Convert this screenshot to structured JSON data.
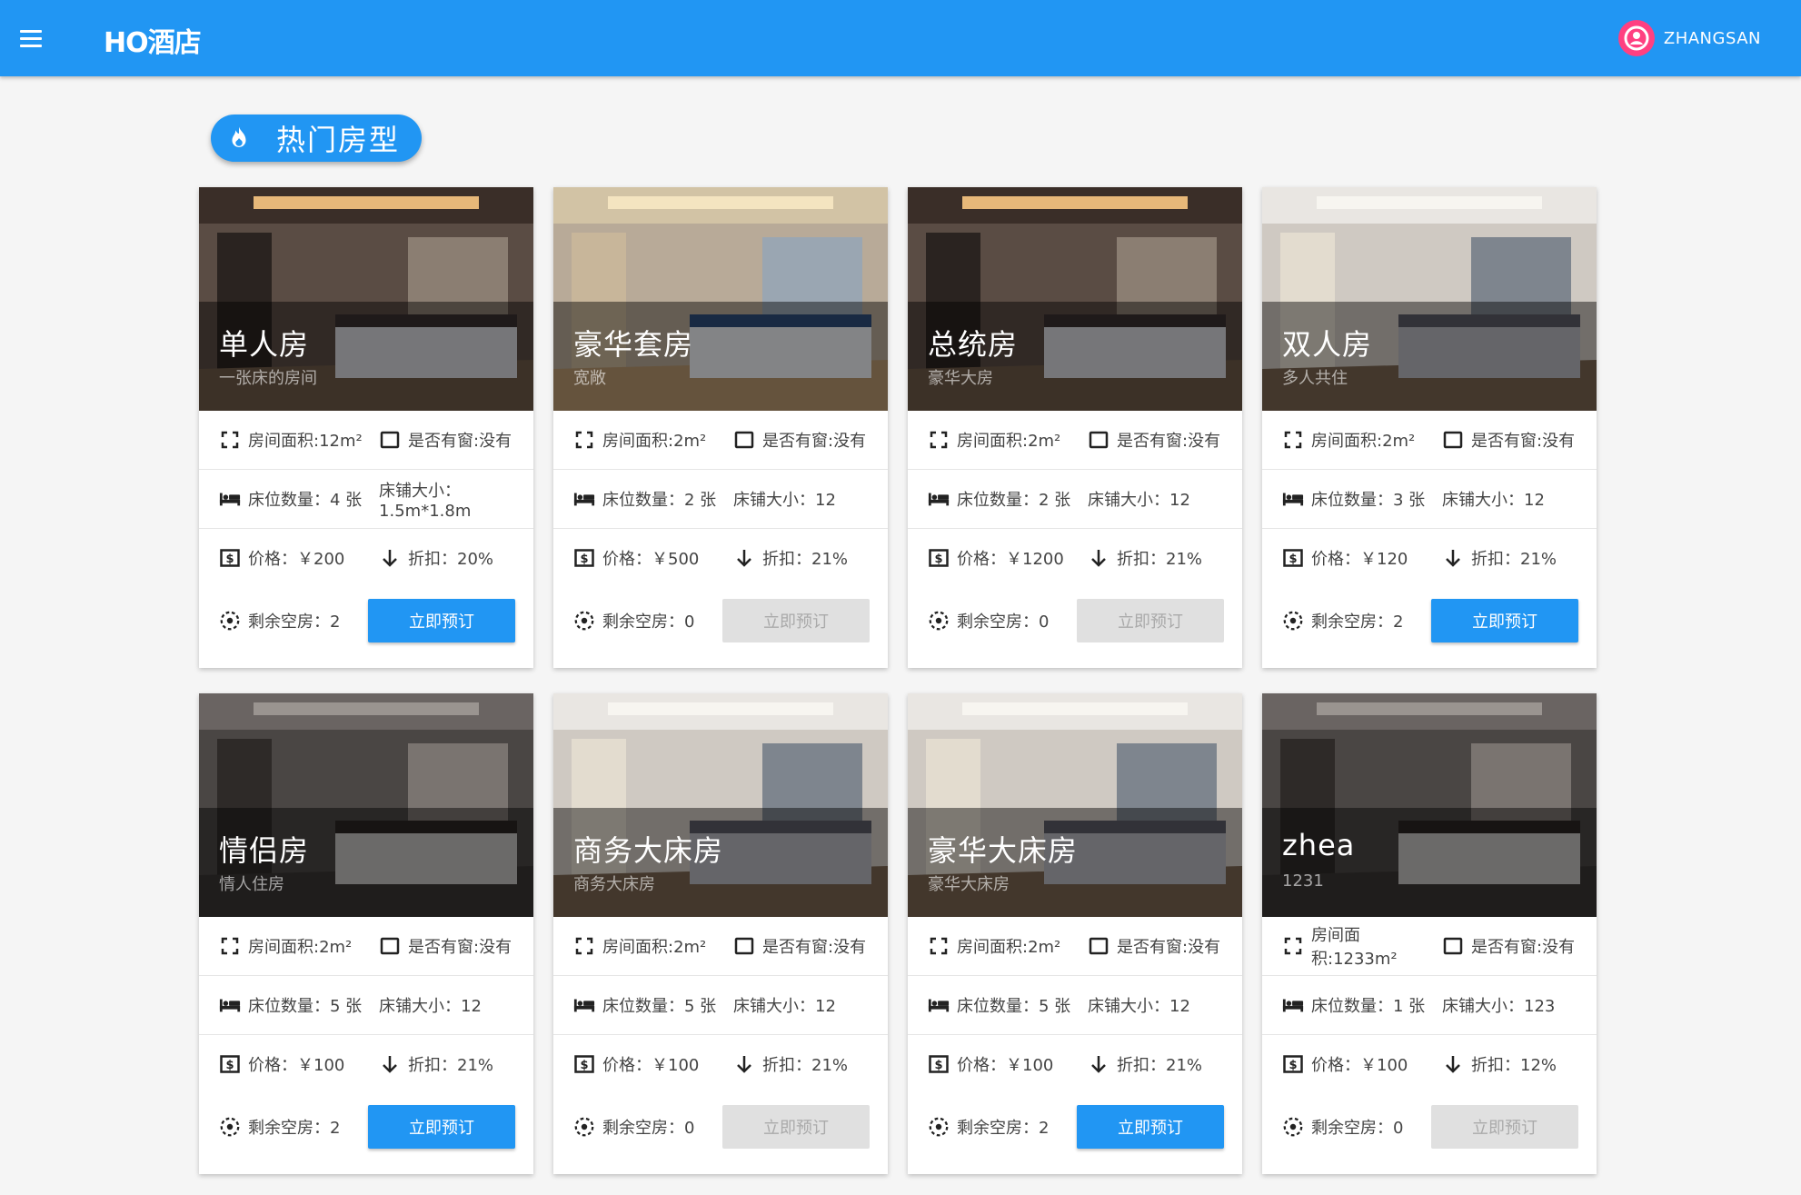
{
  "header": {
    "brand": "HO酒店",
    "username": "ZHANGSAN",
    "brand_color": "#2196f3",
    "avatar_color": "#ff4081"
  },
  "section": {
    "title": "热门房型",
    "icon": "fire-icon"
  },
  "labels": {
    "area_prefix": "房间面积:",
    "area_unit": "m²",
    "window_prefix": "是否有窗:",
    "beds_prefix": "床位数量：",
    "beds_unit": "张",
    "bed_size_prefix": "床铺大小：",
    "price_prefix": "价格：￥",
    "discount_prefix": "折扣：",
    "remaining_prefix": "剩余空房：",
    "book_label": "立即预订"
  },
  "rooms": [
    {
      "name": "单人房",
      "desc": "一张床的房间",
      "area": "12",
      "window": "没有",
      "beds": "4",
      "bed_size": "1.5m*1.8m",
      "price": "200",
      "discount": "20%",
      "remaining": "2",
      "available": true
    },
    {
      "name": "豪华套房",
      "desc": "宽敞",
      "area": "2",
      "window": "没有",
      "beds": "2",
      "bed_size": "12",
      "price": "500",
      "discount": "21%",
      "remaining": "0",
      "available": false
    },
    {
      "name": "总统房",
      "desc": "豪华大房",
      "area": "2",
      "window": "没有",
      "beds": "2",
      "bed_size": "12",
      "price": "1200",
      "discount": "21%",
      "remaining": "0",
      "available": false
    },
    {
      "name": "双人房",
      "desc": "多人共住",
      "area": "2",
      "window": "没有",
      "beds": "3",
      "bed_size": "12",
      "price": "120",
      "discount": "21%",
      "remaining": "2",
      "available": true
    },
    {
      "name": "情侣房",
      "desc": "情人住房",
      "area": "2",
      "window": "没有",
      "beds": "5",
      "bed_size": "12",
      "price": "100",
      "discount": "21%",
      "remaining": "2",
      "available": true
    },
    {
      "name": "商务大床房",
      "desc": "商务大床房",
      "area": "2",
      "window": "没有",
      "beds": "5",
      "bed_size": "12",
      "price": "100",
      "discount": "21%",
      "remaining": "0",
      "available": false
    },
    {
      "name": "豪华大床房",
      "desc": "豪华大床房",
      "area": "2",
      "window": "没有",
      "beds": "5",
      "bed_size": "12",
      "price": "100",
      "discount": "21%",
      "remaining": "2",
      "available": true
    },
    {
      "name": "zhea",
      "desc": "1231",
      "area": "1233",
      "window": "没有",
      "beds": "1",
      "bed_size": "123",
      "price": "100",
      "discount": "12%",
      "remaining": "0",
      "available": false
    }
  ]
}
